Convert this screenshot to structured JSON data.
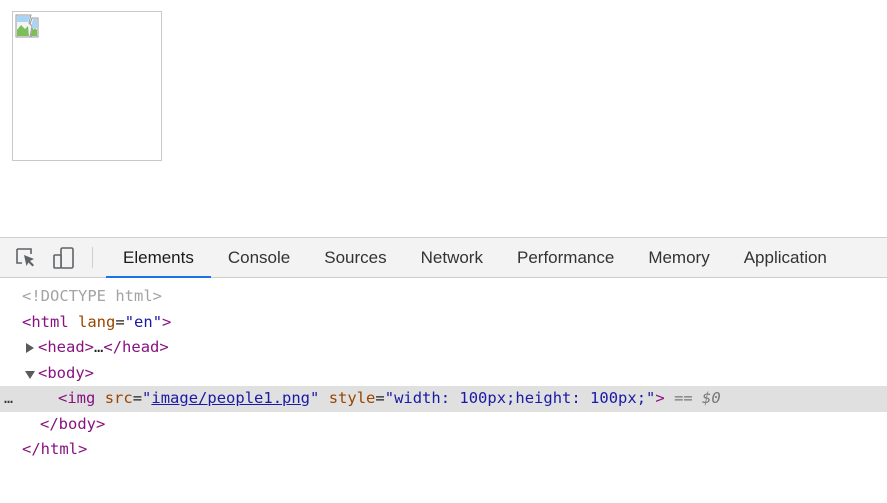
{
  "page": {
    "image_alt": ""
  },
  "devtools": {
    "tabs": [
      {
        "label": "Elements",
        "active": true
      },
      {
        "label": "Console",
        "active": false
      },
      {
        "label": "Sources",
        "active": false
      },
      {
        "label": "Network",
        "active": false
      },
      {
        "label": "Performance",
        "active": false
      },
      {
        "label": "Memory",
        "active": false
      },
      {
        "label": "Application",
        "active": false
      }
    ],
    "tools": {
      "inspect_icon": "inspect-element-icon",
      "device_icon": "device-toolbar-icon"
    },
    "dom": {
      "doctype": "<!DOCTYPE html>",
      "html_open": "html",
      "lang_attr": "lang",
      "lang_val": "en",
      "head_tag": "head",
      "head_collapsed": "…",
      "body_tag": "body",
      "img_tag": "img",
      "src_attr": "src",
      "src_val": "image/people1.png",
      "style_attr": "style",
      "style_val": "width: 100px;height: 100px;",
      "selected_marker": "== $0",
      "row_menu": "…"
    },
    "colors": {
      "accent": "#1a73e8",
      "tag": "#881280",
      "attr_name": "#994500",
      "attr_value": "#1a1aa6"
    }
  }
}
